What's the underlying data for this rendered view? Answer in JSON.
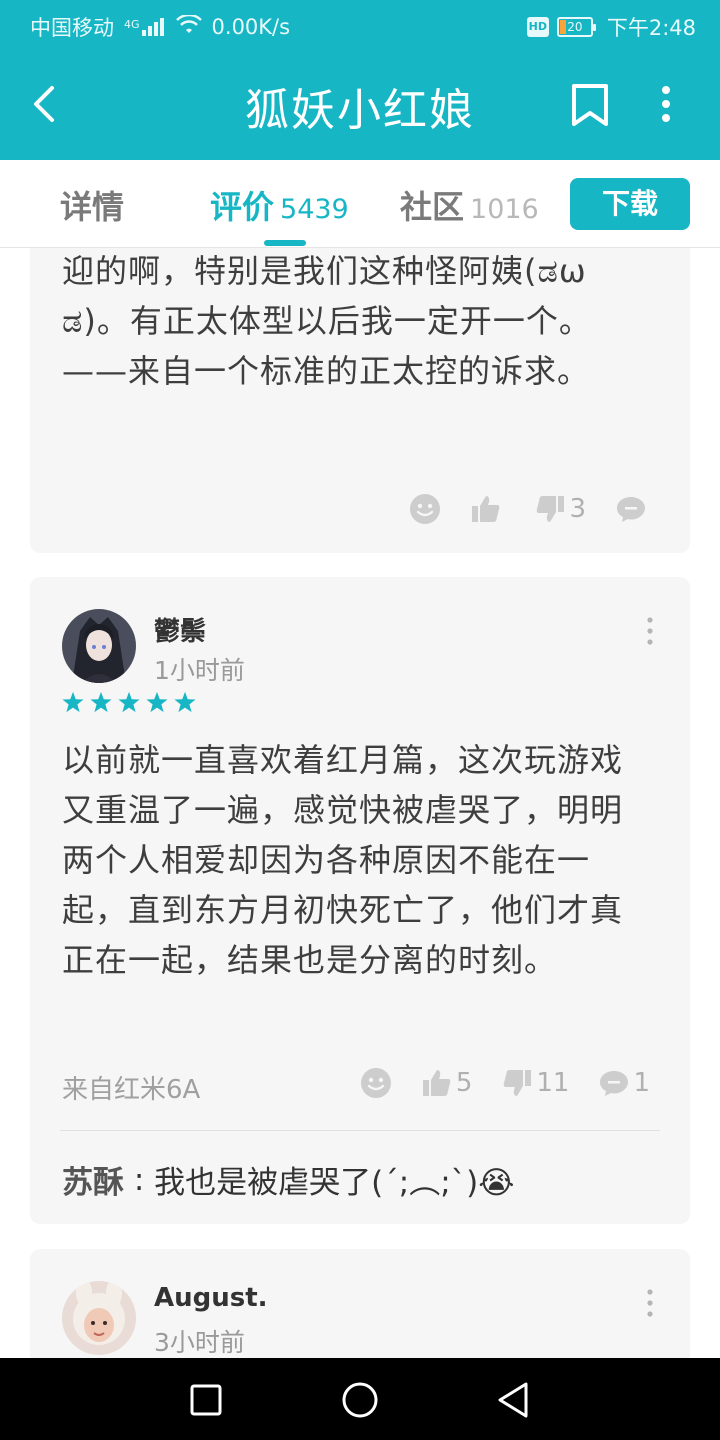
{
  "status_bar": {
    "carrier": "中国移动",
    "network": "4G",
    "speed": "0.00K/s",
    "hd": "HD",
    "battery": "20",
    "time": "下午2:48"
  },
  "app_bar": {
    "title": "狐妖小红娘"
  },
  "tabs": {
    "details": "详情",
    "reviews": "评价",
    "reviews_count": "5439",
    "community": "社区",
    "community_count": "1016",
    "download": "下载"
  },
  "colors": {
    "accent": "#17b6c5",
    "card_bg": "#f6f6f6"
  },
  "reviews": [
    {
      "text": "在一个正太体型上说，对正太也很受欢迎的啊，特别是我们这种怪阿姨(ಡωಡ)。有正太体型以后我一定开一个。——来自一个标准的正太控的诉求。",
      "likes": "",
      "dislikes": "3",
      "comments": ""
    },
    {
      "username": "鬱鬃",
      "time": "1小时前",
      "rating": 5,
      "text": "以前就一直喜欢着红月篇，这次玩游戏又重温了一遍，感觉快被虐哭了，明明两个人相爱却因为各种原因不能在一起，直到东方月初快死亡了，他们才真正在一起，结果也是分离的时刻。",
      "device": "来自红米6A",
      "likes": "5",
      "dislikes": "11",
      "comments": "1",
      "reply_user": "苏酥",
      "reply_text": "我也是被虐哭了(´;︵;`)😭"
    },
    {
      "username": "August.",
      "time": "3小时前"
    }
  ],
  "icons": {
    "back": "back-arrow-icon",
    "bookmark": "bookmark-icon",
    "more": "more-vertical-icon",
    "emoji": "smiley-icon",
    "like": "thumbs-up-icon",
    "dislike": "thumbs-down-icon",
    "comment": "comment-bubble-icon"
  }
}
